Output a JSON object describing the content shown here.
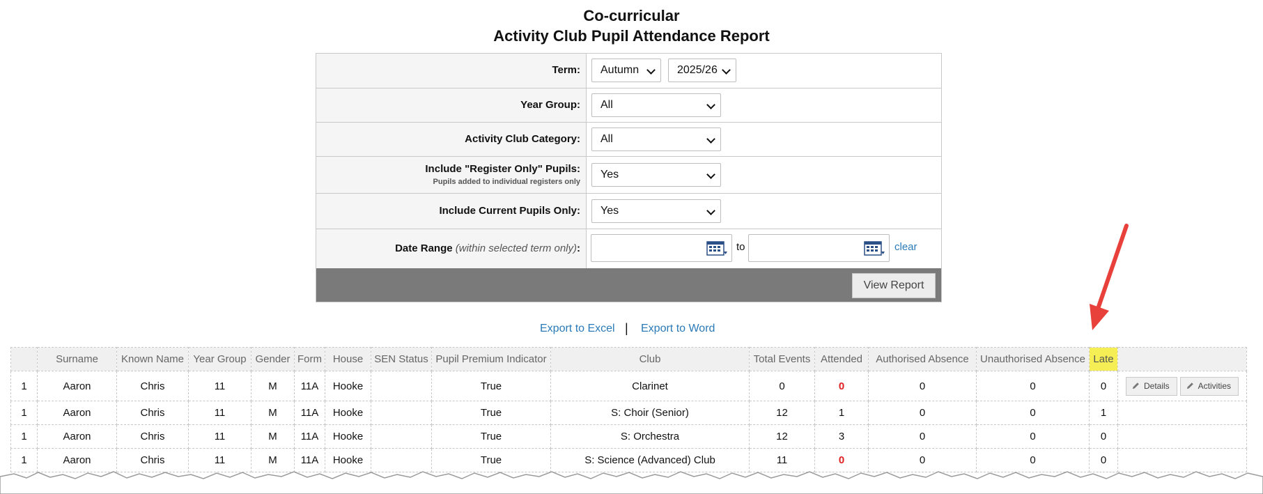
{
  "page": {
    "title": "Co-curricular",
    "subtitle": "Activity Club Pupil Attendance Report"
  },
  "filters": {
    "term": {
      "label": "Term:",
      "term_value": "Autumn",
      "year_value": "2025/26"
    },
    "year_group": {
      "label": "Year Group:",
      "value": "All"
    },
    "category": {
      "label": "Activity Club Category:",
      "value": "All"
    },
    "register_only": {
      "label": "Include \"Register Only\" Pupils:",
      "sublabel": "Pupils added to individual registers only",
      "value": "Yes"
    },
    "current_only": {
      "label": "Include Current Pupils Only:",
      "value": "Yes"
    },
    "date_range": {
      "label": "Date Range",
      "label_note": "(within selected term only)",
      "label_colon": ":",
      "from_value": "",
      "to_text": "to",
      "to_value": "",
      "clear_label": "clear"
    },
    "view_button": "View Report"
  },
  "exports": {
    "excel": "Export to Excel",
    "separator": "|",
    "word": "Export to Word"
  },
  "table": {
    "columns": [
      "",
      "Surname",
      "Known Name",
      "Year Group",
      "Gender",
      "Form",
      "House",
      "SEN Status",
      "Pupil Premium Indicator",
      "Club",
      "Total Events",
      "Attended",
      "Authorised Absence",
      "Unauthorised Absence",
      "Late",
      ""
    ],
    "rows": [
      {
        "num": "1",
        "surname": "Aaron",
        "known": "Chris",
        "year": "11",
        "gender": "M",
        "form": "11A",
        "house": "Hooke",
        "sen": "",
        "premium": "True",
        "club": "Clarinet",
        "total": "0",
        "attended": "0",
        "auth": "0",
        "unauth": "0",
        "late": "0"
      },
      {
        "num": "1",
        "surname": "Aaron",
        "known": "Chris",
        "year": "11",
        "gender": "M",
        "form": "11A",
        "house": "Hooke",
        "sen": "",
        "premium": "True",
        "club": "S: Choir (Senior)",
        "total": "12",
        "attended": "1",
        "auth": "0",
        "unauth": "0",
        "late": "1"
      },
      {
        "num": "1",
        "surname": "Aaron",
        "known": "Chris",
        "year": "11",
        "gender": "M",
        "form": "11A",
        "house": "Hooke",
        "sen": "",
        "premium": "True",
        "club": "S: Orchestra",
        "total": "12",
        "attended": "3",
        "auth": "0",
        "unauth": "0",
        "late": "0"
      },
      {
        "num": "1",
        "surname": "Aaron",
        "known": "Chris",
        "year": "11",
        "gender": "M",
        "form": "11A",
        "house": "Hooke",
        "sen": "",
        "premium": "True",
        "club": "S: Science (Advanced) Club",
        "total": "11",
        "attended": "0",
        "auth": "0",
        "unauth": "0",
        "late": "0"
      }
    ],
    "row_buttons": {
      "details": "Details",
      "activities": "Activities"
    }
  },
  "colors": {
    "late_highlight": "#f5ef55",
    "zero_attended": "#e02020",
    "link": "#2a7ab8",
    "arrow": "#e8403a"
  }
}
